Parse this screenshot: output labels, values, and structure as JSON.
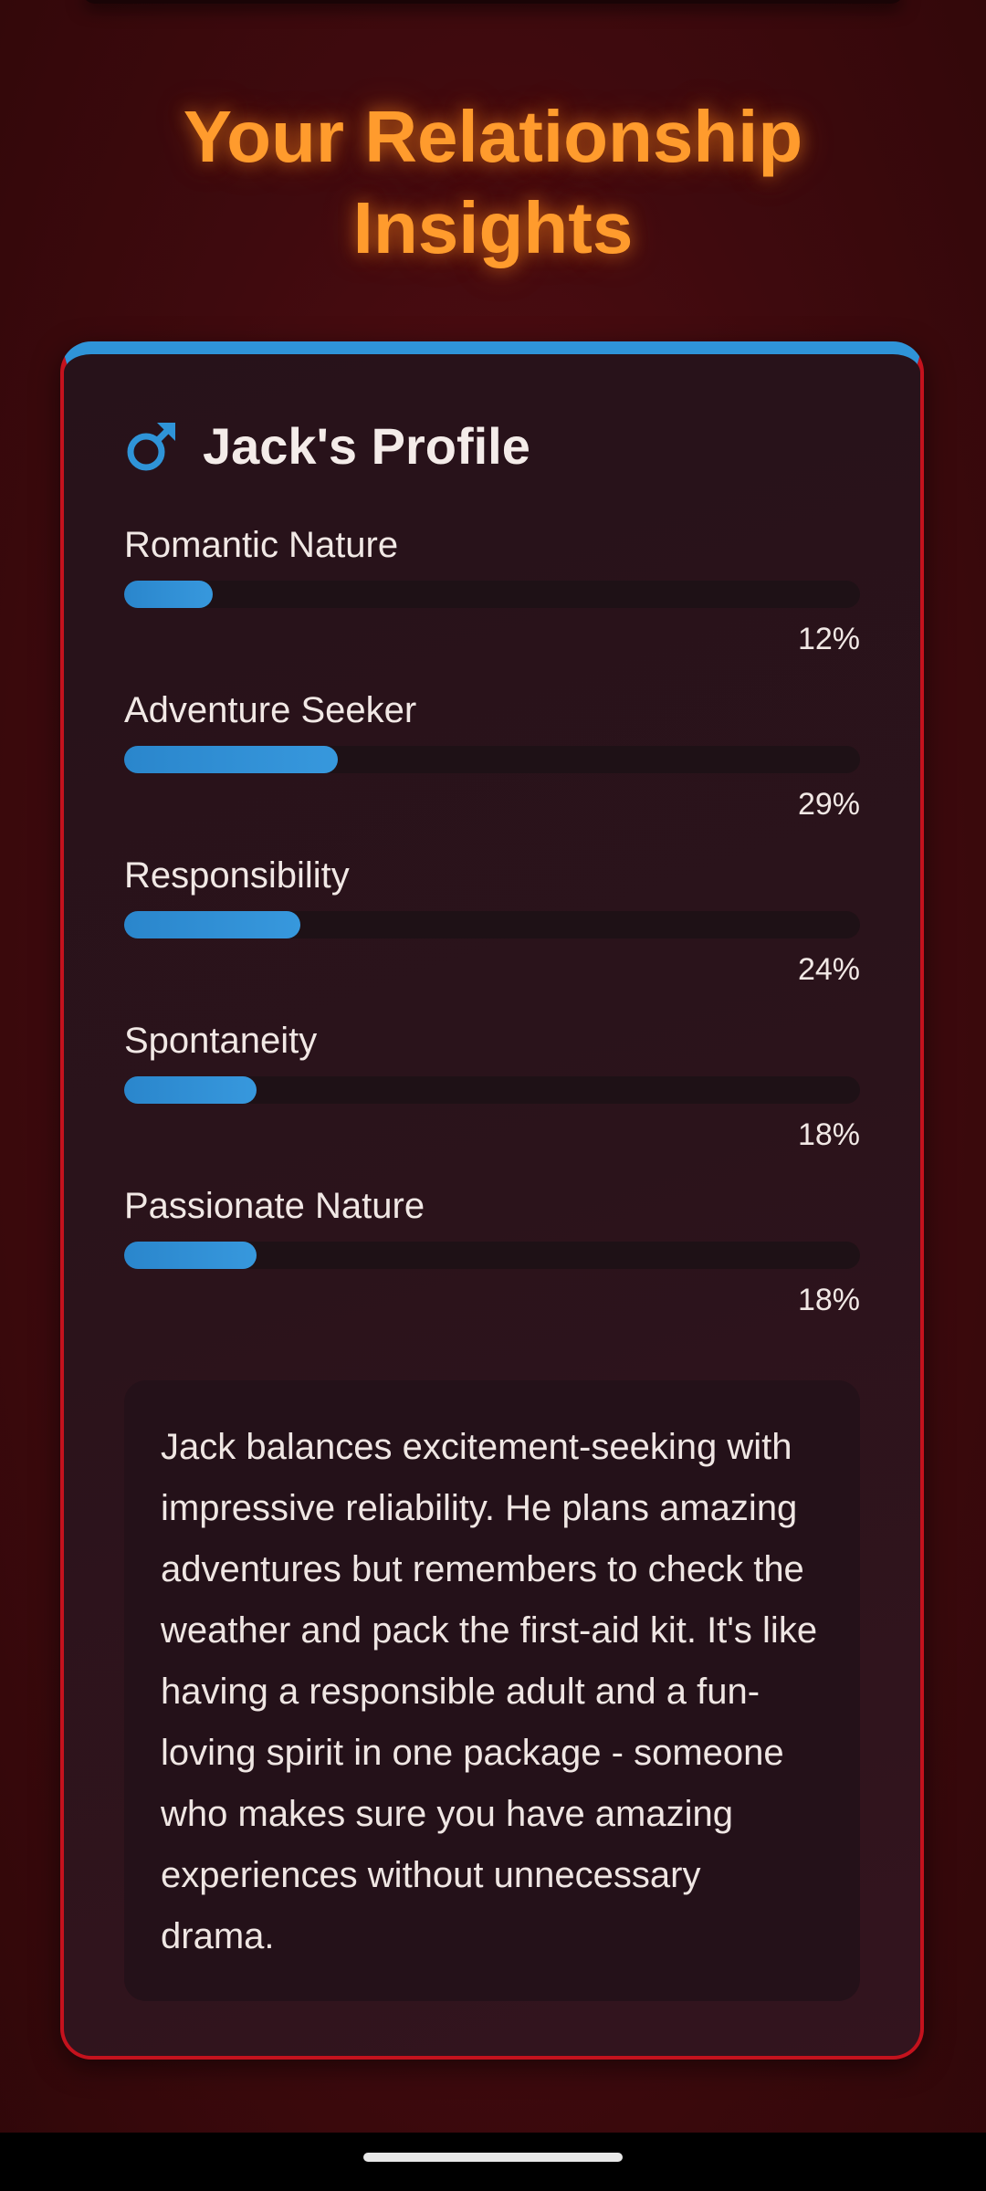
{
  "page": {
    "title_line1": "Your Relationship",
    "title_line2": "Insights"
  },
  "profile": {
    "icon": "male-symbol-icon",
    "title": "Jack's Profile",
    "accent_color": "#2f94d8",
    "border_color": "#c4121d",
    "traits": [
      {
        "label": "Romantic Nature",
        "value": 12,
        "display": "12%"
      },
      {
        "label": "Adventure Seeker",
        "value": 29,
        "display": "29%"
      },
      {
        "label": "Responsibility",
        "value": 24,
        "display": "24%"
      },
      {
        "label": "Spontaneity",
        "value": 18,
        "display": "18%"
      },
      {
        "label": "Passionate Nature",
        "value": 18,
        "display": "18%"
      }
    ],
    "description": "Jack balances excitement-seeking with impressive reliability. He plans amazing adventures but remembers to check the weather and pack the first-aid kit. It's like having a responsible adult and a fun-loving spirit in one package - someone who makes sure you have amazing experiences without unnecessary drama."
  },
  "colors": {
    "title": "#ff9b2d",
    "bar_fill": "#3798dd",
    "background": "#3f0a0e"
  }
}
